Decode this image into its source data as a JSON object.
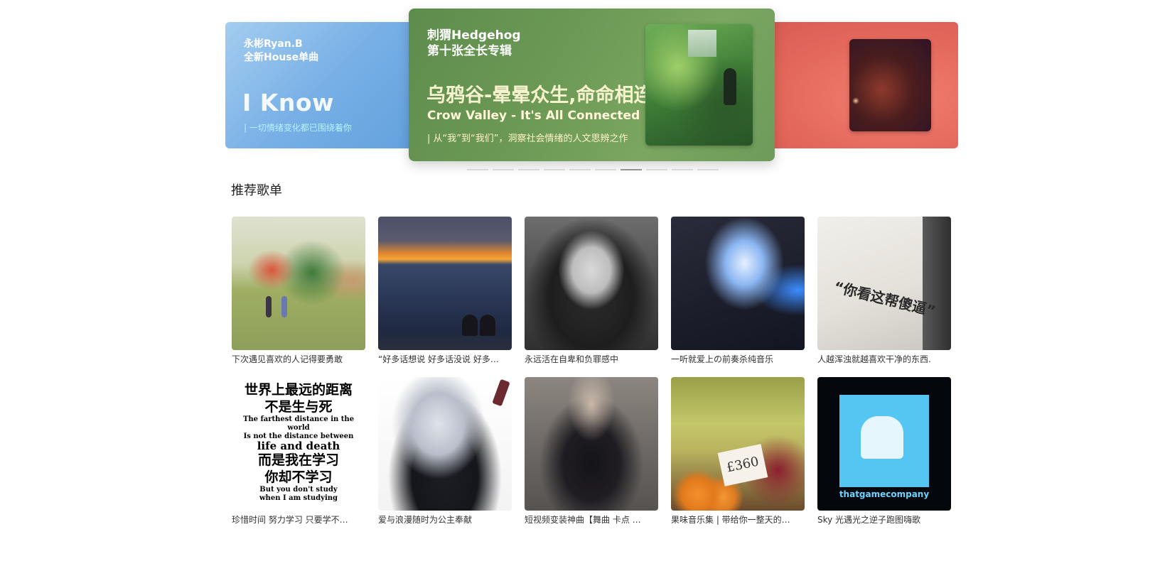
{
  "banner": {
    "left": {
      "artist_line1": "永彬Ryan.B",
      "artist_line2": "全新House单曲",
      "title": "I Know",
      "tagline": "| 一切情绪变化都已围绕着你"
    },
    "center": {
      "artist_line1": "刺猬Hedgehog",
      "artist_line2": "第十张全长专辑",
      "title": "乌鸦谷-晕晕众生,命命相连",
      "subtitle": "Crow Valley - It's All Connected",
      "tagline": "| 从“我”到“我们”，洞察社会情绪的人文思辨之作"
    },
    "dots_count": 10,
    "active_dot_index": 6
  },
  "section": {
    "title": "推荐歌单"
  },
  "playlists": [
    {
      "title": "下次遇见喜欢的人记得要勇敢",
      "cover": "park"
    },
    {
      "title": "“好多话想说 好多话没说 好多…",
      "cover": "sea"
    },
    {
      "title": "永远活在自卑和负罪感中",
      "cover": "girl"
    },
    {
      "title": "一听就爱上の前奏杀纯音乐",
      "cover": "flower"
    },
    {
      "title": "人越浑浊就越喜欢干净的东西.",
      "cover": "wall",
      "cover_text": "“你看这帮傻逼”"
    },
    {
      "title": "珍惜时间 努力学习 只要学不…",
      "cover": "text",
      "cover_lines": {
        "zh1": "世界上最远的距离",
        "zh2": "不是生与死",
        "en1": "The farthest distance in the world",
        "en2": "Is not the distance between",
        "en3": "life and death",
        "zh3": "而是我在学习",
        "zh4": "你却不学习",
        "en4": "But you don't study",
        "en5": "when I am studying"
      }
    },
    {
      "title": "爱与浪漫随时为公主奉献",
      "cover": "anime"
    },
    {
      "title": "短视频变装神曲【舞曲 卡点 …",
      "cover": "photo"
    },
    {
      "title": "果味音乐集 | 带给你一整天的…",
      "cover": "fruit",
      "cover_text": "£360"
    },
    {
      "title": "Sky 光遇光之逆子跑图嗨歌",
      "cover": "sky",
      "cover_text": "thatgamecompany"
    }
  ]
}
